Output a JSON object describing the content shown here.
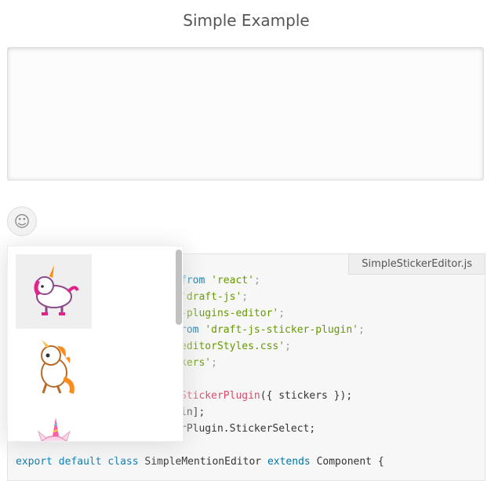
{
  "page": {
    "title": "Simple Example"
  },
  "toolbar": {
    "sticker_button_icon": "smiley-face-icon",
    "sticker_button_glyph": "☺"
  },
  "code": {
    "filename": "SimpleStickerEditor.js",
    "lines": [
      [
        [
          "from ",
          "kw"
        ],
        [
          "'react'",
          "str"
        ],
        [
          ";",
          "punc"
        ]
      ],
      [
        [
          "'draft-js'",
          "str"
        ],
        [
          ";",
          "punc"
        ]
      ],
      [
        [
          "-plugins-editor'",
          "str"
        ],
        [
          ";",
          "punc"
        ]
      ],
      [
        [
          "rom ",
          "kw"
        ],
        [
          "'draft-js-sticker-plugin'",
          "str"
        ],
        [
          ";",
          "punc"
        ]
      ],
      [
        [
          "editorStyles.css'",
          "str"
        ],
        [
          ";",
          "punc"
        ]
      ],
      [
        [
          "kers'",
          "str"
        ],
        [
          ";",
          "punc"
        ]
      ],
      [],
      [
        [
          "StickerPlugin",
          "fn"
        ],
        [
          "({ stickers });",
          "plain"
        ]
      ],
      [
        [
          "in];",
          "plain"
        ]
      ],
      [
        [
          "rPlugin.StickerSelect;",
          "plain"
        ]
      ],
      [],
      [
        [
          "export ",
          "kw"
        ],
        [
          "default ",
          "kw"
        ],
        [
          "class ",
          "kw"
        ],
        [
          "SimpleMentionEditor ",
          "plain"
        ],
        [
          "extends ",
          "kw"
        ],
        [
          "Component {",
          "plain"
        ]
      ]
    ]
  },
  "sticker_picker": {
    "stickers": [
      {
        "name": "unicorn-pink-sticker",
        "selected": true
      },
      {
        "name": "unicorn-orange-sticker",
        "selected": false
      },
      {
        "name": "unicorn-head-sticker",
        "selected": false
      }
    ]
  },
  "colors": {
    "keyword": "#0077aa",
    "string": "#669900",
    "function": "#dd4a68",
    "punctuation": "#999999"
  }
}
